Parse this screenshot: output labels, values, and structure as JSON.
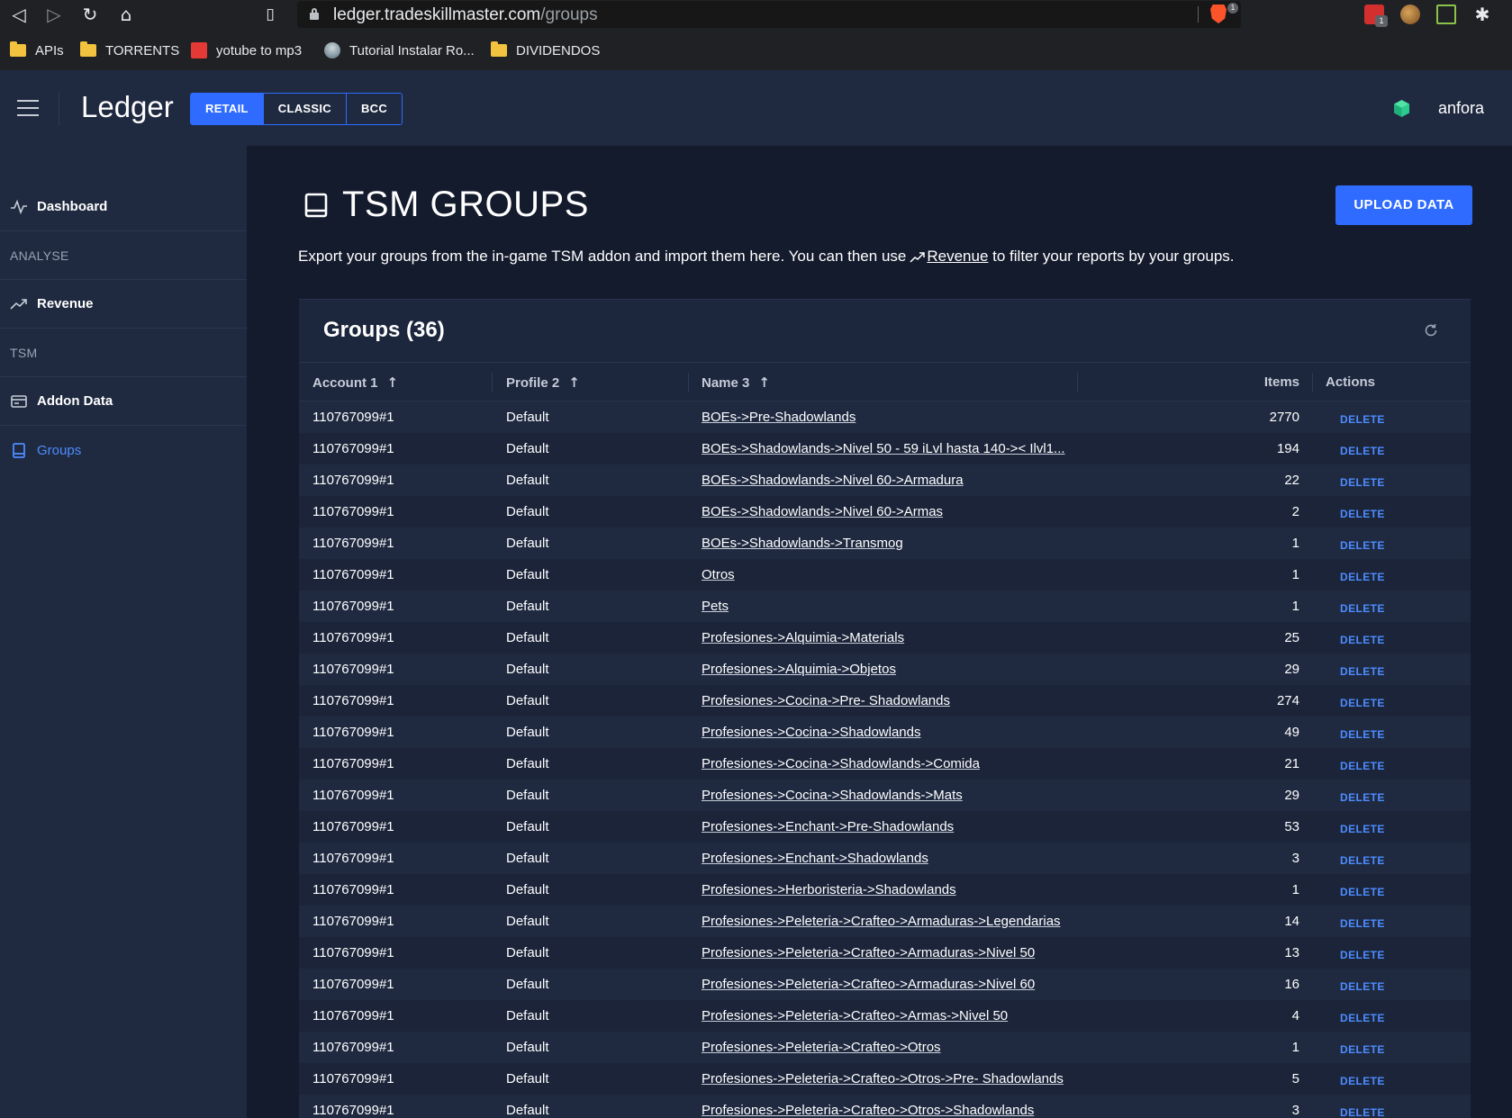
{
  "browser": {
    "url_host": "ledger.tradeskillmaster.com",
    "url_path": "/groups",
    "brave_badge": "1",
    "ext_badge": "1",
    "bookmarks": [
      {
        "label": "APIs",
        "icon": "folder-icon"
      },
      {
        "label": "TORRENTS",
        "icon": "folder-icon"
      },
      {
        "label": "yotube to mp3",
        "icon": "youtube-favicon"
      },
      {
        "label": "Tutorial Instalar Ro...",
        "icon": "globe-favicon"
      },
      {
        "label": "DIVIDENDOS",
        "icon": "folder-icon"
      }
    ]
  },
  "header": {
    "brand": "Ledger",
    "variants": [
      "RETAIL",
      "CLASSIC",
      "BCC"
    ],
    "active_variant": "RETAIL",
    "username": "anfora",
    "accent": "#2f6bff"
  },
  "sidebar": {
    "dashboard": "Dashboard",
    "section_analyse": "ANALYSE",
    "revenue": "Revenue",
    "section_tsm": "TSM",
    "addon_data": "Addon Data",
    "groups": "Groups"
  },
  "main": {
    "title": "TSM GROUPS",
    "upload_button": "UPLOAD DATA",
    "desc_before": "Export your groups from the in-game TSM addon and import them here. You can then use",
    "desc_link": "Revenue",
    "desc_after": "to filter your reports by your groups.",
    "card_title": "Groups (36)"
  },
  "table": {
    "columns": {
      "account": "Account 1",
      "profile": "Profile 2",
      "name": "Name 3",
      "items": "Items",
      "actions": "Actions"
    },
    "delete_label": "DELETE",
    "rows": [
      {
        "account": "110767099#1",
        "profile": "Default",
        "name": "BOEs->Pre-Shadowlands",
        "items": "2770"
      },
      {
        "account": "110767099#1",
        "profile": "Default",
        "name": "BOEs->Shadowlands->Nivel 50 - 59 iLvl hasta 140->< Ilvl1...",
        "items": "194"
      },
      {
        "account": "110767099#1",
        "profile": "Default",
        "name": "BOEs->Shadowlands->Nivel 60->Armadura",
        "items": "22"
      },
      {
        "account": "110767099#1",
        "profile": "Default",
        "name": "BOEs->Shadowlands->Nivel 60->Armas",
        "items": "2"
      },
      {
        "account": "110767099#1",
        "profile": "Default",
        "name": "BOEs->Shadowlands->Transmog",
        "items": "1"
      },
      {
        "account": "110767099#1",
        "profile": "Default",
        "name": "Otros",
        "items": "1"
      },
      {
        "account": "110767099#1",
        "profile": "Default",
        "name": "Pets",
        "items": "1"
      },
      {
        "account": "110767099#1",
        "profile": "Default",
        "name": "Profesiones->Alquimia->Materials",
        "items": "25"
      },
      {
        "account": "110767099#1",
        "profile": "Default",
        "name": "Profesiones->Alquimia->Objetos",
        "items": "29"
      },
      {
        "account": "110767099#1",
        "profile": "Default",
        "name": "Profesiones->Cocina->Pre- Shadowlands",
        "items": "274"
      },
      {
        "account": "110767099#1",
        "profile": "Default",
        "name": "Profesiones->Cocina->Shadowlands",
        "items": "49"
      },
      {
        "account": "110767099#1",
        "profile": "Default",
        "name": "Profesiones->Cocina->Shadowlands->Comida",
        "items": "21"
      },
      {
        "account": "110767099#1",
        "profile": "Default",
        "name": "Profesiones->Cocina->Shadowlands->Mats",
        "items": "29"
      },
      {
        "account": "110767099#1",
        "profile": "Default",
        "name": "Profesiones->Enchant->Pre-Shadowlands",
        "items": "53"
      },
      {
        "account": "110767099#1",
        "profile": "Default",
        "name": "Profesiones->Enchant->Shadowlands",
        "items": "3"
      },
      {
        "account": "110767099#1",
        "profile": "Default",
        "name": "Profesiones->Herboristeria->Shadowlands",
        "items": "1"
      },
      {
        "account": "110767099#1",
        "profile": "Default",
        "name": "Profesiones->Peleteria->Crafteo->Armaduras->Legendarias",
        "items": "14"
      },
      {
        "account": "110767099#1",
        "profile": "Default",
        "name": "Profesiones->Peleteria->Crafteo->Armaduras->Nivel 50",
        "items": "13"
      },
      {
        "account": "110767099#1",
        "profile": "Default",
        "name": "Profesiones->Peleteria->Crafteo->Armaduras->Nivel 60",
        "items": "16"
      },
      {
        "account": "110767099#1",
        "profile": "Default",
        "name": "Profesiones->Peleteria->Crafteo->Armas->Nivel 50",
        "items": "4"
      },
      {
        "account": "110767099#1",
        "profile": "Default",
        "name": "Profesiones->Peleteria->Crafteo->Otros",
        "items": "1"
      },
      {
        "account": "110767099#1",
        "profile": "Default",
        "name": "Profesiones->Peleteria->Crafteo->Otros->Pre- Shadowlands",
        "items": "5"
      },
      {
        "account": "110767099#1",
        "profile": "Default",
        "name": "Profesiones->Peleteria->Crafteo->Otros->Shadowlands",
        "items": "3"
      }
    ]
  }
}
